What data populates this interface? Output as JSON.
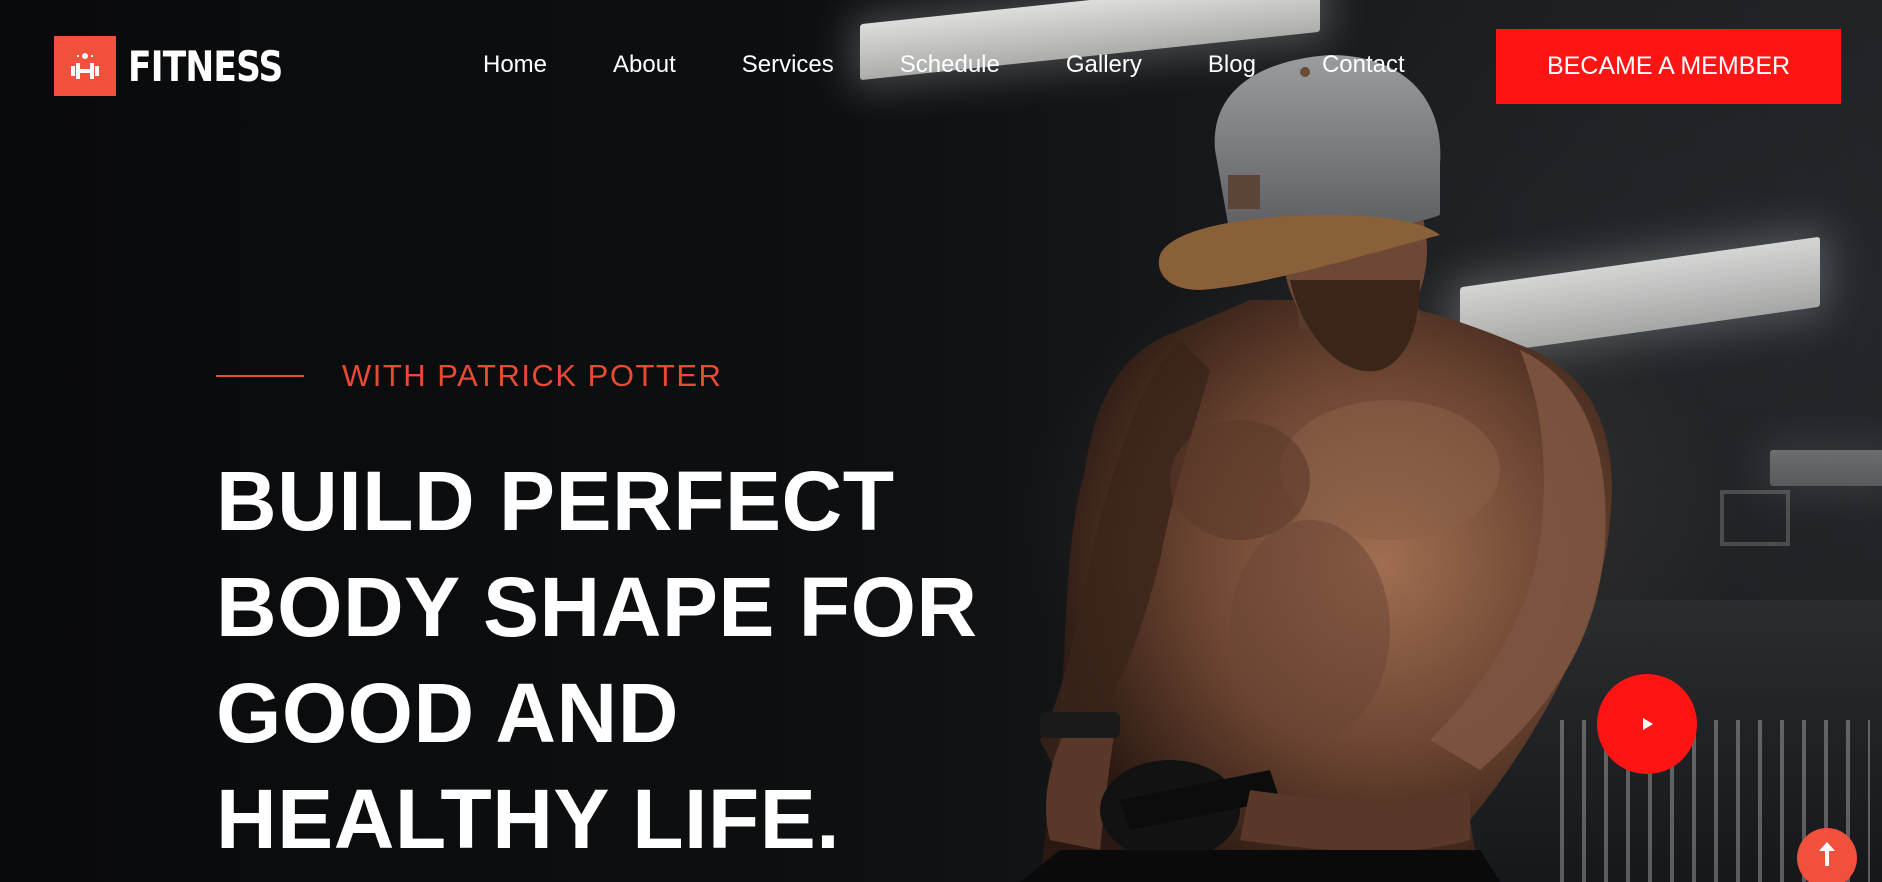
{
  "brand": {
    "name": "FITNESS",
    "logo_icon": "dumbbell-icon",
    "accent_color": "#f0503c"
  },
  "nav": {
    "items": [
      {
        "label": "Home"
      },
      {
        "label": "About"
      },
      {
        "label": "Services"
      },
      {
        "label": "Schedule"
      },
      {
        "label": "Gallery"
      },
      {
        "label": "Blog"
      },
      {
        "label": "Contact"
      }
    ]
  },
  "cta": {
    "label": "BECAME A MEMBER",
    "color": "#ff1414"
  },
  "hero": {
    "subtitle": "WITH PATRICK POTTER",
    "headline_lines": [
      "BUILD PERFECT",
      "BODY SHAPE FOR",
      "GOOD AND",
      "HEALTHY LIFE."
    ],
    "play_icon": "play-icon"
  },
  "scroll_top": {
    "icon": "arrow-up-icon"
  }
}
